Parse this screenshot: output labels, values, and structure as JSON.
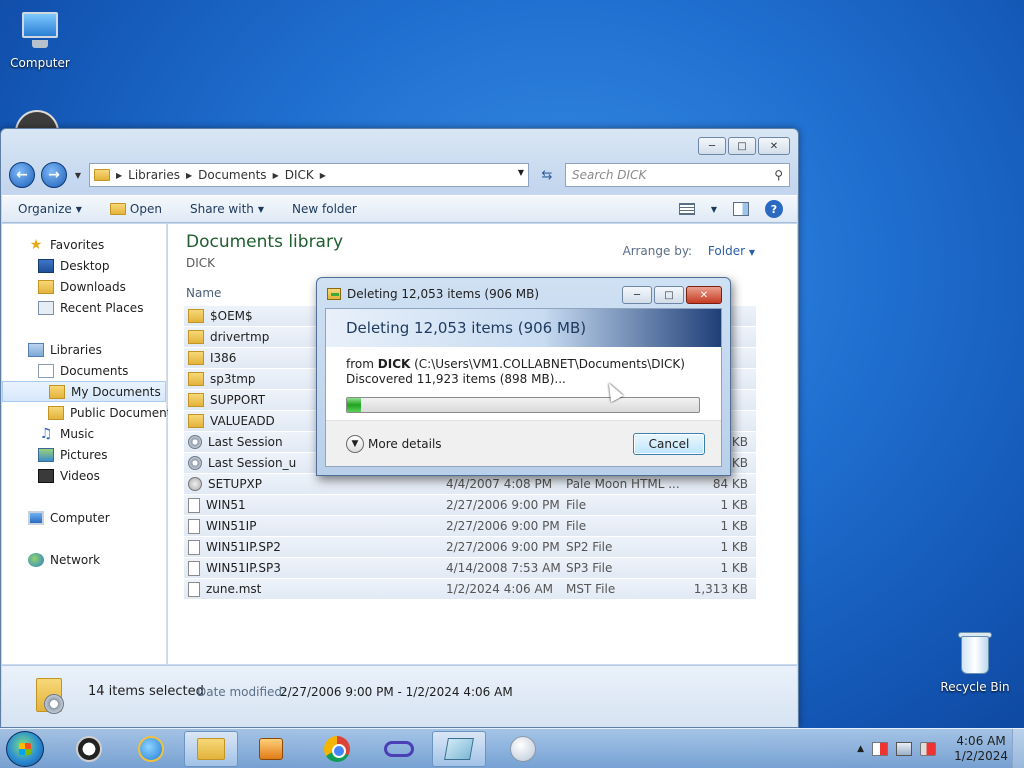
{
  "desktop": {
    "icons": [
      {
        "label": "Computer",
        "icon": "computer-icon"
      },
      {
        "label": "Recycle Bin",
        "icon": "recycle-bin-icon"
      }
    ]
  },
  "explorer": {
    "breadcrumb": [
      "Libraries",
      "Documents",
      "DICK"
    ],
    "search_placeholder": "Search DICK",
    "toolbar": {
      "organize": "Organize",
      "open": "Open",
      "share_with": "Share with",
      "new_folder": "New folder"
    },
    "nav": {
      "favorites": "Favorites",
      "desktop": "Desktop",
      "downloads": "Downloads",
      "recent_places": "Recent Places",
      "libraries": "Libraries",
      "documents": "Documents",
      "my_documents": "My Documents",
      "public_documents": "Public Documents",
      "music": "Music",
      "pictures": "Pictures",
      "videos": "Videos",
      "computer": "Computer",
      "network": "Network"
    },
    "content": {
      "title": "Documents library",
      "subtitle": "DICK",
      "arrange_label": "Arrange by:",
      "arrange_value": "Folder",
      "column_name": "Name"
    },
    "files": [
      {
        "name": "$OEM$",
        "date": "",
        "type": "",
        "size": "",
        "icon": "folder"
      },
      {
        "name": "drivertmp",
        "date": "",
        "type": "",
        "size": "",
        "icon": "folder"
      },
      {
        "name": "I386",
        "date": "",
        "type": "",
        "size": "",
        "icon": "folder"
      },
      {
        "name": "sp3tmp",
        "date": "",
        "type": "",
        "size": "",
        "icon": "folder"
      },
      {
        "name": "SUPPORT",
        "date": "",
        "type": "",
        "size": "",
        "icon": "folder"
      },
      {
        "name": "VALUEADD",
        "date": "",
        "type": "",
        "size": "",
        "icon": "folder"
      },
      {
        "name": "Last Session",
        "date": "",
        "type": "",
        "size": "7 KB",
        "icon": "settings"
      },
      {
        "name": "Last Session_u",
        "date": "",
        "type": "",
        "size": "2 KB",
        "icon": "settings"
      },
      {
        "name": "SETUPXP",
        "date": "4/4/2007 4:08 PM",
        "type": "Pale Moon HTML ...",
        "size": "84 KB",
        "icon": "html"
      },
      {
        "name": "WIN51",
        "date": "2/27/2006 9:00 PM",
        "type": "File",
        "size": "1 KB",
        "icon": "file"
      },
      {
        "name": "WIN51IP",
        "date": "2/27/2006 9:00 PM",
        "type": "File",
        "size": "1 KB",
        "icon": "file"
      },
      {
        "name": "WIN51IP.SP2",
        "date": "2/27/2006 9:00 PM",
        "type": "SP2 File",
        "size": "1 KB",
        "icon": "file"
      },
      {
        "name": "WIN51IP.SP3",
        "date": "4/14/2008 7:53 AM",
        "type": "SP3 File",
        "size": "1 KB",
        "icon": "file"
      },
      {
        "name": "zune.mst",
        "date": "1/2/2024 4:06 AM",
        "type": "MST File",
        "size": "1,313 KB",
        "icon": "file"
      }
    ],
    "details": {
      "count": "14 items selected",
      "date_label": "Date modified:",
      "date_value": "2/27/2006 9:00 PM - 1/2/2024 4:06 AM"
    }
  },
  "dialog": {
    "title": "Deleting 12,053 items (906 MB)",
    "header": "Deleting 12,053 items (906 MB)",
    "from_prefix": "from",
    "from_name": "DICK",
    "from_path": "(C:\\Users\\VM1.COLLABNET\\Documents\\DICK)",
    "discovered": "Discovered 11,923 items (898 MB)...",
    "progress_fraction": 0.04,
    "more_details": "More details",
    "cancel": "Cancel"
  },
  "taskbar": {
    "time": "4:06 AM",
    "date": "1/2/2024"
  }
}
